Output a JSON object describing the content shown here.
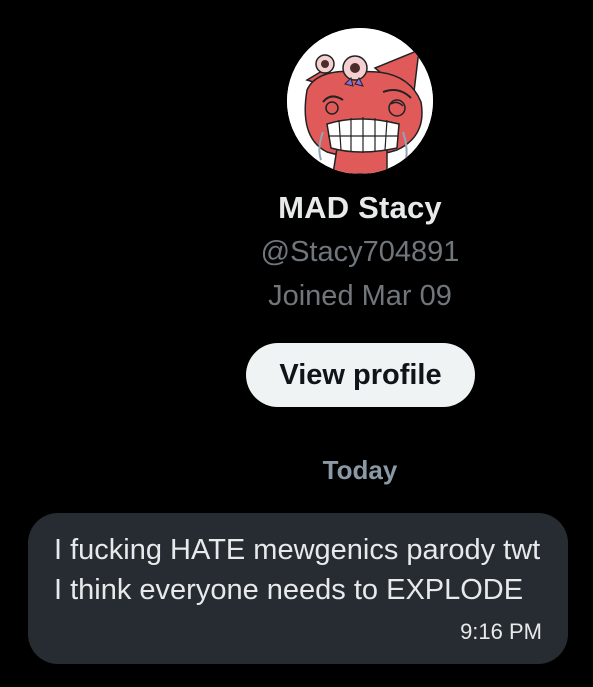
{
  "profile": {
    "display_name": "MAD Stacy",
    "handle": "@Stacy704891",
    "joined": "Joined Mar 09",
    "view_profile_label": "View profile"
  },
  "conversation": {
    "date_divider": "Today",
    "messages": [
      {
        "text": "I fucking HATE mewgenics parody twt I think everyone needs to EXPLODE",
        "time": "9:16 PM"
      }
    ]
  },
  "colors": {
    "background": "#000000",
    "primary_text": "#e7e9ea",
    "secondary_text": "#71767b",
    "button_bg": "#eff3f4",
    "bubble_bg": "#262c31",
    "avatar_cat": "#e05a5a"
  },
  "icons": {
    "avatar": "angry-red-cat-avatar"
  }
}
